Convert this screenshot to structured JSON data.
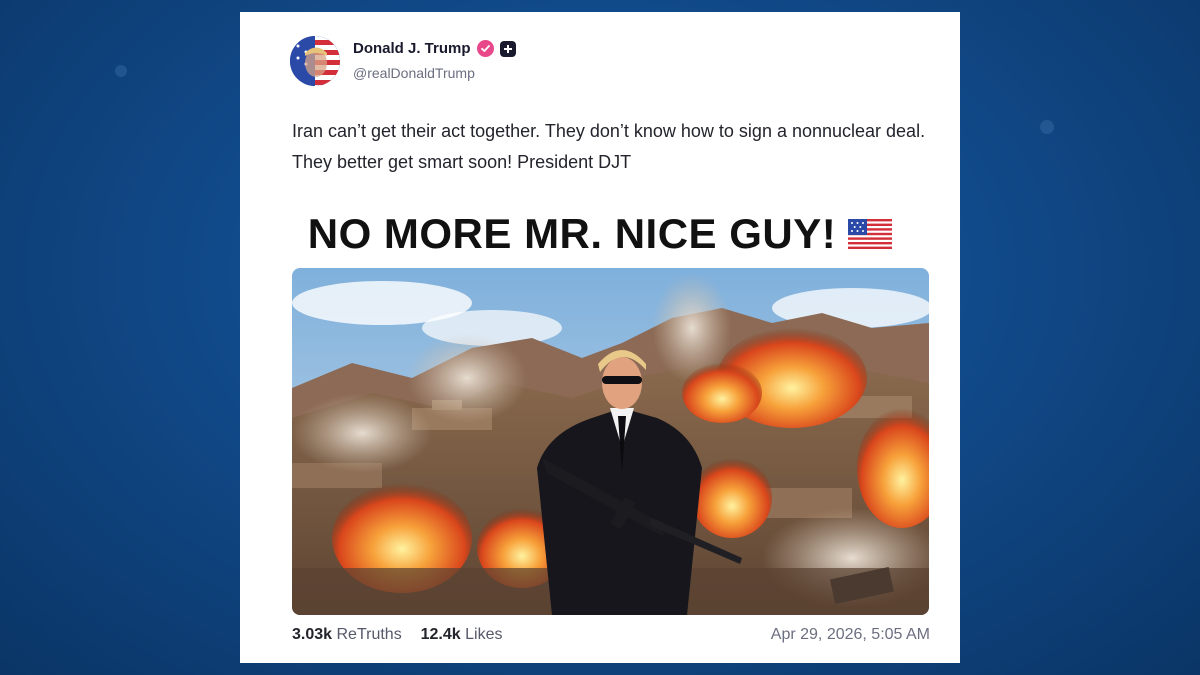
{
  "post": {
    "display_name": "Donald J. Trump",
    "handle": "@realDonaldTrump",
    "text": "Iran can’t get their act together. They don’t know how to sign a nonnuclear deal. They better get smart soon! President DJT",
    "image_headline": "NO MORE MR. NICE GUY!",
    "image_headline_icon": "us-flag-emoji",
    "retruths_count": "3.03k",
    "retruths_label": "ReTruths",
    "likes_count": "12.4k",
    "likes_label": "Likes",
    "timestamp": "Apr 29, 2026, 5:05 AM"
  },
  "icons": {
    "verified": "verified-badge-icon",
    "plus": "plus-badge-icon"
  },
  "colors": {
    "background": "#114a8a",
    "card": "#ffffff",
    "verified_badge": "#e8488a",
    "text_primary": "#23242c",
    "text_secondary": "#6b6f80"
  }
}
